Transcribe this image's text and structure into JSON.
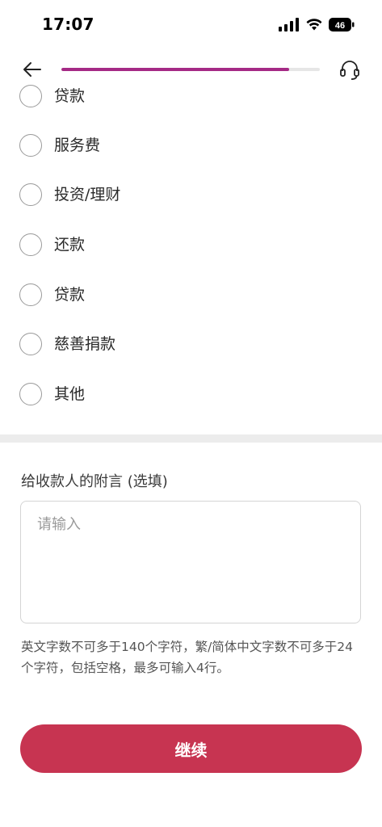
{
  "status_bar": {
    "time": "17:07",
    "battery": "46"
  },
  "nav": {
    "progress": 0.88,
    "colors": {
      "progress_fill": "#a52a85",
      "progress_track": "#e6e6e6"
    }
  },
  "purpose_options": [
    {
      "label": "贷款"
    },
    {
      "label": "服务费"
    },
    {
      "label": "投资/理财"
    },
    {
      "label": "还款"
    },
    {
      "label": "贷款"
    },
    {
      "label": "慈善捐款"
    },
    {
      "label": "其他"
    }
  ],
  "memo": {
    "label": "给收款人的附言 (选填)",
    "placeholder": "请输入",
    "hint": "英文字数不可多于140个字符，繁/简体中文字数不可多于24个字符，包括空格，最多可输入4行。"
  },
  "continue_button": {
    "label": "继续",
    "color": "#c73451"
  }
}
